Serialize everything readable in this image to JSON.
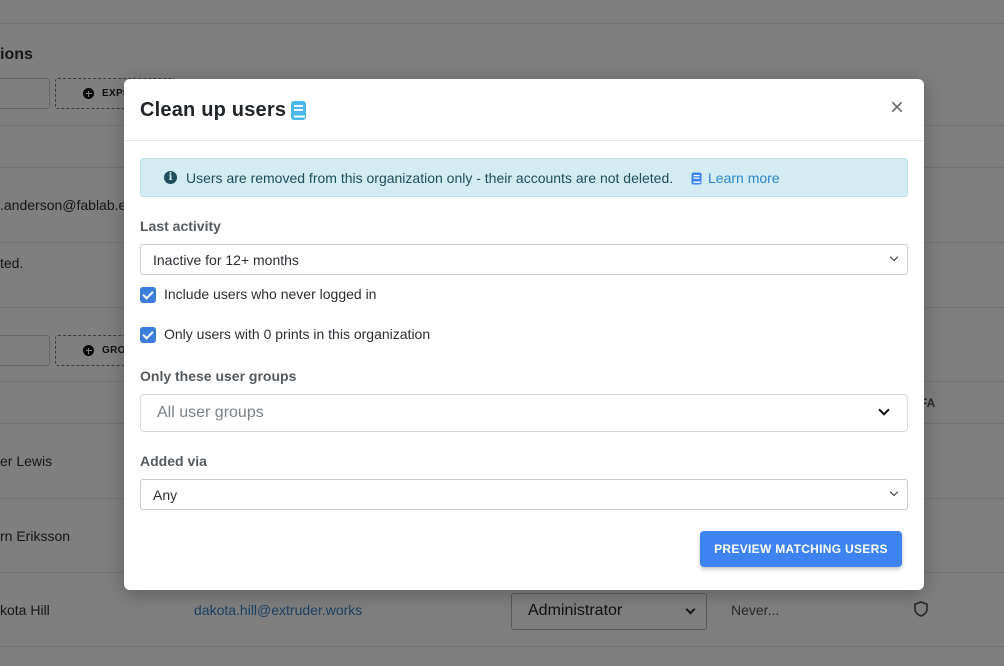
{
  "background": {
    "section_heading": "ions",
    "expire_button": "EXPI",
    "group_button": "GROU",
    "email_partial": ".anderson@fablab.e",
    "note_partial": "ted.",
    "column_mfa": "FA",
    "rows": [
      {
        "name": "er Lewis"
      },
      {
        "name": "rn Eriksson"
      },
      {
        "name": "kota Hill",
        "email": "dakota.hill@extruder.works",
        "role": "Administrator",
        "last_login": "Never..."
      }
    ]
  },
  "modal": {
    "title": "Clean up users",
    "close_symbol": "×",
    "alert": {
      "message": "Users are removed from this organization only - their accounts are not deleted.",
      "link": "Learn more"
    },
    "last_activity": {
      "label": "Last activity",
      "selected": "Inactive for 12+ months"
    },
    "checkboxes": [
      {
        "label": "Include users who never logged in",
        "checked": true
      },
      {
        "label": "Only users with 0 prints in this organization",
        "checked": true
      }
    ],
    "user_groups": {
      "label": "Only these user groups",
      "placeholder": "All user groups"
    },
    "added_via": {
      "label": "Added via",
      "selected": "Any"
    },
    "preview_button": "PREVIEW MATCHING USERS"
  },
  "colors": {
    "primary": "#3d84f0",
    "alert_bg": "#d2ecf2",
    "link": "#2f86c9",
    "checkbox": "#3b7ddd"
  },
  "icons": [
    "book-icon",
    "close-icon",
    "info-icon",
    "chevron-down-icon",
    "check-icon",
    "shield-icon",
    "plus-circle-icon"
  ]
}
